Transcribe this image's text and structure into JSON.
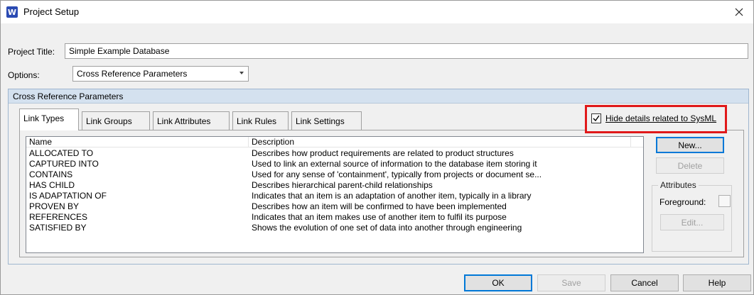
{
  "window": {
    "title": "Project Setup",
    "app_icon_letter": "W"
  },
  "form": {
    "project_title_label": "Project Title:",
    "project_title_value": "Simple Example Database",
    "options_label": "Options:",
    "options_value": "Cross Reference Parameters"
  },
  "group": {
    "title": "Cross Reference Parameters"
  },
  "tabs": [
    {
      "label": "Link Types",
      "active": true
    },
    {
      "label": "Link Groups",
      "active": false
    },
    {
      "label": "Link Attributes",
      "active": false
    },
    {
      "label": "Link Rules",
      "active": false
    },
    {
      "label": "Link Settings",
      "active": false
    }
  ],
  "hide_sysml": {
    "label": "Hide details related to SysML",
    "checked": true
  },
  "table": {
    "columns": [
      "Name",
      "Description"
    ],
    "rows": [
      {
        "name": "ALLOCATED TO",
        "description": "Describes how product requirements are related to product structures"
      },
      {
        "name": "CAPTURED INTO",
        "description": "Used to link an external source of information to the database item storing it"
      },
      {
        "name": "CONTAINS",
        "description": "Used for any sense of 'containment', typically from projects or document se..."
      },
      {
        "name": "HAS CHILD",
        "description": "Describes hierarchical parent-child relationships"
      },
      {
        "name": "IS ADAPTATION OF",
        "description": "Indicates that an item is an adaptation of another item, typically in a library"
      },
      {
        "name": "PROVEN BY",
        "description": "Describes how an item will be confirmed to have been implemented"
      },
      {
        "name": "REFERENCES",
        "description": "Indicates that an item makes use of another item to fulfil its purpose"
      },
      {
        "name": "SATISFIED BY",
        "description": "Shows the evolution of one set of data into another through engineering"
      }
    ]
  },
  "side": {
    "new_label": "New...",
    "delete_label": "Delete",
    "attributes_title": "Attributes",
    "foreground_label": "Foreground:",
    "edit_label": "Edit..."
  },
  "footer": {
    "ok": "OK",
    "save": "Save",
    "cancel": "Cancel",
    "help": "Help"
  },
  "colors": {
    "highlight_box": "#e0191a",
    "group_header": "#d4e1ef",
    "default_button_border": "#0078d7"
  }
}
